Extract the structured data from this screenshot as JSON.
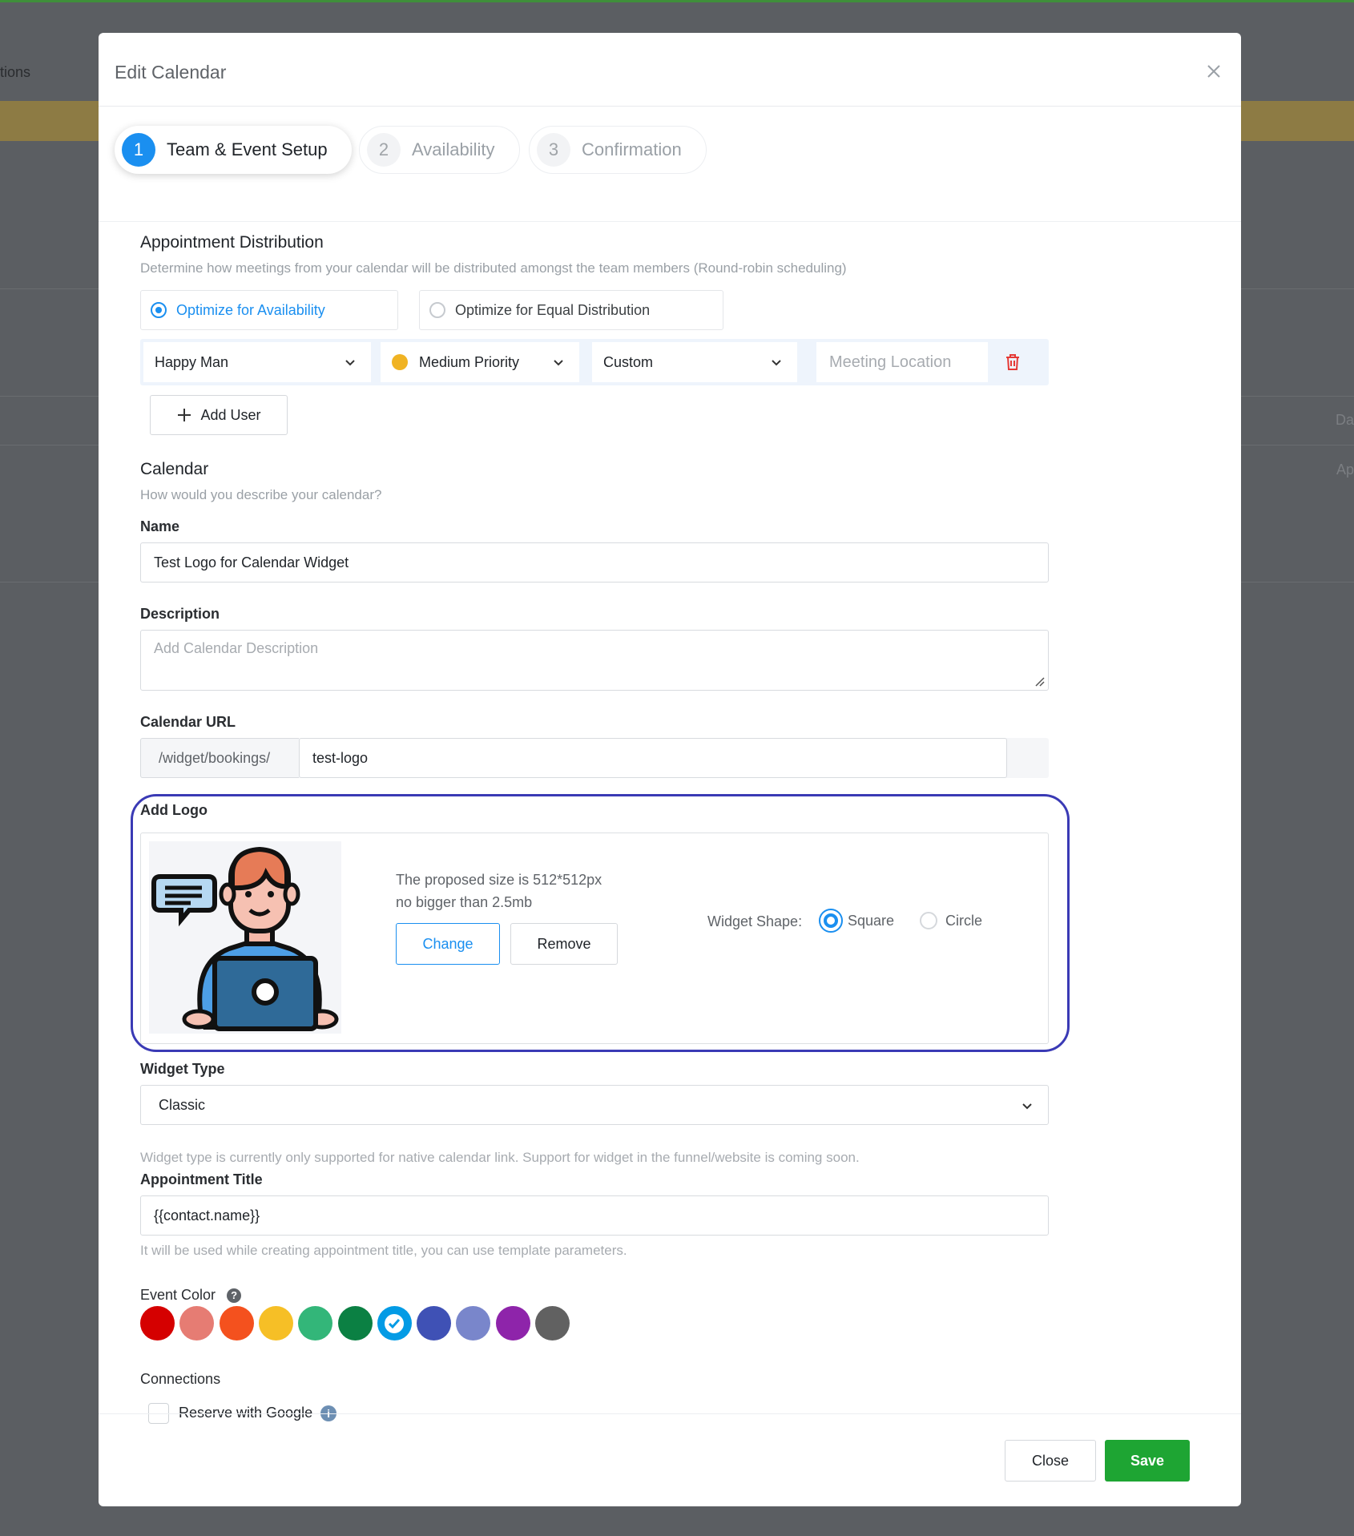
{
  "background": {
    "left_text": "tions",
    "right_text_1": "Da",
    "right_text_2": "Ap"
  },
  "modal": {
    "title": "Edit Calendar",
    "close_icon": "close-icon"
  },
  "steps": [
    {
      "num": "1",
      "label": "Team & Event Setup",
      "active": true
    },
    {
      "num": "2",
      "label": "Availability",
      "active": false
    },
    {
      "num": "3",
      "label": "Confirmation",
      "active": false
    }
  ],
  "distribution": {
    "title": "Appointment Distribution",
    "subtitle": "Determine how meetings from your calendar will be distributed amongst the team members (Round-robin scheduling)",
    "option_availability": "Optimize for Availability",
    "option_equal": "Optimize for Equal Distribution",
    "selected": "availability"
  },
  "user_row": {
    "user": "Happy Man",
    "priority": "Medium Priority",
    "priority_color": "#f0b323",
    "location_type": "Custom",
    "location_placeholder": "Meeting Location",
    "delete_icon": "trash-icon"
  },
  "add_user_label": "Add User",
  "calendar": {
    "title": "Calendar",
    "subtitle": "How would you describe your calendar?",
    "name_label": "Name",
    "name_value": "Test Logo for Calendar Widget",
    "description_label": "Description",
    "description_placeholder": "Add Calendar Description",
    "url_label": "Calendar URL",
    "url_prefix": "/widget/bookings/",
    "url_value": "test-logo"
  },
  "logo": {
    "label": "Add Logo",
    "size_hint_1": "The proposed size is 512*512px",
    "size_hint_2": "no bigger than 2.5mb",
    "change_label": "Change",
    "remove_label": "Remove",
    "shape_label": "Widget Shape:",
    "shape_square": "Square",
    "shape_circle": "Circle",
    "shape_selected": "square"
  },
  "widget": {
    "type_label": "Widget Type",
    "type_value": "Classic",
    "type_note": "Widget type is currently only supported for native calendar link. Support for widget in the funnel/website is coming soon."
  },
  "appointment": {
    "title_label": "Appointment Title",
    "title_value": "{{contact.name}}",
    "title_note": "It will be used while creating appointment title, you can use template parameters."
  },
  "event_color": {
    "label": "Event Color",
    "colors": [
      "#d50000",
      "#e67c73",
      "#f4511e",
      "#f6bf26",
      "#33b679",
      "#0b8043",
      "#039be5",
      "#3f51b5",
      "#7986cb",
      "#8e24aa",
      "#616161"
    ],
    "selected_index": 6
  },
  "connections": {
    "label": "Connections",
    "reserve_google": "Reserve with Google"
  },
  "footer": {
    "close_label": "Close",
    "save_label": "Save",
    "save_color": "#1ea533"
  }
}
